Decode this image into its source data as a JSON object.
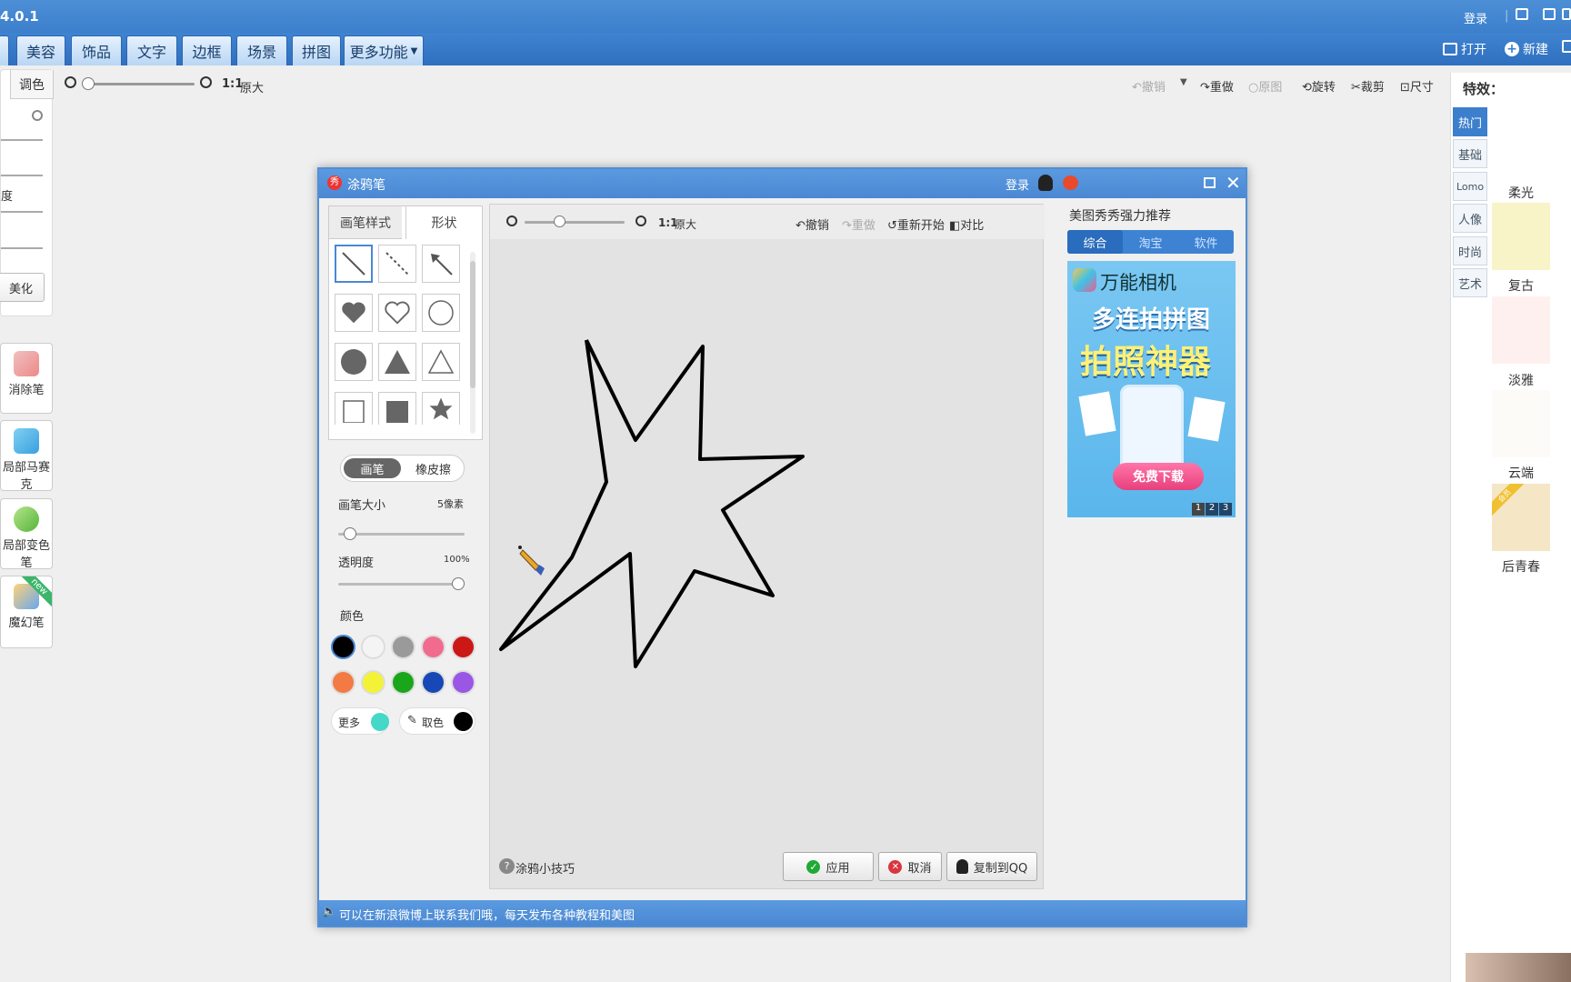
{
  "app": {
    "version": "4.0.1",
    "login": "登录"
  },
  "main_tabs": [
    "美容",
    "饰品",
    "文字",
    "边框",
    "场景",
    "拼图",
    "更多功能"
  ],
  "top_right": {
    "open": "打开",
    "new": "新建"
  },
  "toolbar": {
    "zoom_ratio": "1:1",
    "zoom_label": "原大",
    "undo": "撤销",
    "redo": "重做",
    "original": "原图",
    "rotate": "旋转",
    "crop": "裁剪",
    "size": "尺寸"
  },
  "left_panel": {
    "tone_tab": "调色",
    "partial_label": "度",
    "beautify": "美化"
  },
  "left_tools": [
    "消除笔",
    "局部马赛克",
    "局部变色笔",
    "魔幻笔"
  ],
  "new_badge": "new",
  "effects": {
    "title": "特效：",
    "tabs": [
      "热门",
      "基础",
      "Lomo",
      "人像",
      "时尚",
      "艺术"
    ],
    "items": [
      {
        "label": "柔光",
        "color": "#ffffff"
      },
      {
        "label": "复古",
        "color": "#f9f3c8"
      },
      {
        "label": "淡雅",
        "color": "#fff0f0"
      },
      {
        "label": "云端",
        "color": "#fdfbf8"
      },
      {
        "label": "后青春",
        "color": "#f5e6c6"
      }
    ],
    "badge": "会员"
  },
  "dialog": {
    "title": "涂鸦笔",
    "login": "登录",
    "style_tabs": [
      "画笔样式",
      "形状"
    ],
    "shapes": [
      "line-icon",
      "dashed-line-icon",
      "arrow-icon",
      "heart-filled-icon",
      "heart-outline-icon",
      "circle-outline-icon",
      "circle-filled-icon",
      "triangle-filled-icon",
      "triangle-outline-icon",
      "square-outline-icon",
      "square-filled-icon",
      "star-filled-icon"
    ],
    "mode": {
      "brush": "画笔",
      "eraser": "橡皮擦"
    },
    "brush_size_label": "画笔大小",
    "brush_size_value": "5像素",
    "opacity_label": "透明度",
    "opacity_value": "100%",
    "brush_level": 0.05,
    "opacity_level": 1.0,
    "color_label": "颜色",
    "colors": [
      "#000000",
      "#f4f4f4",
      "#9a9a9a",
      "#f06b8d",
      "#cc1717",
      "#f47a43",
      "#f3f237",
      "#1aa61a",
      "#1748b5",
      "#9a57e6"
    ],
    "more_label": "更多",
    "more_color": "#45d7c8",
    "picker_label": "取色",
    "picker_color": "#000000",
    "canvas_toolbar": {
      "zoom_ratio": "1:1",
      "zoom_label": "原大",
      "undo": "撤销",
      "redo": "重做",
      "restart": "重新开始",
      "compare": "对比"
    },
    "tips": "涂鸦小技巧",
    "apply": "应用",
    "cancel": "取消",
    "copy_qq": "复制到QQ",
    "status": "可以在新浪微博上联系我们哦，每天发布各种教程和美图",
    "recommend": {
      "title": "美图秀秀强力推荐",
      "tabs": [
        "综合",
        "淘宝",
        "软件"
      ],
      "ad_brand": "万能相机",
      "ad_line1": "多连拍拼图",
      "ad_line2": "拍照神器",
      "ad_button": "免费下载",
      "pages": [
        "1",
        "2",
        "3"
      ]
    }
  }
}
